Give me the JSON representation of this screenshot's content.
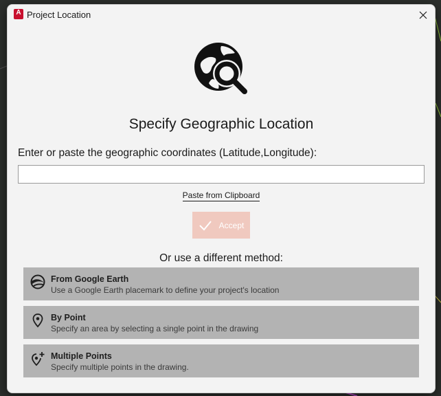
{
  "window": {
    "title": "Project Location",
    "app_icon": "autodesk-app-icon",
    "app_icon_letter": "A"
  },
  "main": {
    "heading": "Specify Geographic Location",
    "coordinates_label": "Enter or paste the geographic coordinates (Latitude,Longitude):",
    "coordinates_value": "",
    "paste_link": "Paste from Clipboard",
    "accept_label": "Accept",
    "alternative_label": "Or use a different method:"
  },
  "methods": [
    {
      "title": "From Google Earth",
      "description": "Use a Google Earth placemark to define your project's location",
      "icon": "google-earth-icon"
    },
    {
      "title": "By Point",
      "description": "Specify an area by selecting a single point in the drawing",
      "icon": "map-pin-icon"
    },
    {
      "title": "Multiple Points",
      "description": "Specify multiple points in the drawing.",
      "icon": "map-pin-plus-icon"
    }
  ],
  "colors": {
    "accent_disabled": "#f0c9bf",
    "app_icon_red": "#c8102e",
    "method_bg": "#b3b3b3",
    "dialog_bg": "#f3f3f3"
  }
}
